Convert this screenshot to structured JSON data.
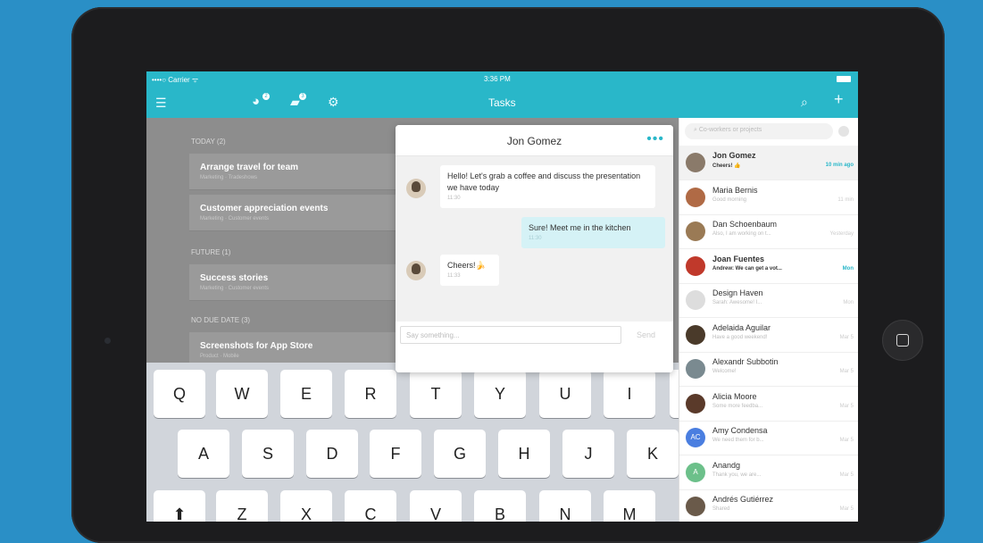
{
  "status": {
    "carrier": "••••○ Carrier ᯤ",
    "time": "3:36 PM"
  },
  "nav": {
    "title": "Tasks",
    "badge1": "2",
    "badge2": "3"
  },
  "tasks": {
    "sections": [
      {
        "label": "TODAY (2)",
        "items": [
          {
            "title": "Arrange travel for team",
            "sub": "Marketing · Tradeshows"
          },
          {
            "title": "Customer appreciation events",
            "sub": "Marketing · Customer events"
          }
        ]
      },
      {
        "label": "FUTURE (1)",
        "items": [
          {
            "title": "Success stories",
            "sub": "Marketing · Customer events"
          }
        ]
      },
      {
        "label": "NO DUE DATE (3)",
        "items": [
          {
            "title": "Screenshots for App Store",
            "sub": "Product · Mobile"
          }
        ]
      }
    ]
  },
  "chat": {
    "name": "Jon Gomez",
    "more": "•••",
    "messages": [
      {
        "text": "Hello! Let's grab a coffee and discuss the presentation we have today",
        "time": "11:30"
      },
      {
        "text": "Sure! Meet me in the kitchen",
        "time": "11:30"
      },
      {
        "text": "Cheers!🍌",
        "time": "11:33"
      }
    ],
    "input_placeholder": "Say something...",
    "send_label": "Send"
  },
  "keyboard": {
    "row1": [
      "Q",
      "W",
      "E",
      "R",
      "T",
      "Y",
      "U",
      "I"
    ],
    "row2": [
      "A",
      "S",
      "D",
      "F",
      "G",
      "H",
      "J",
      "K"
    ],
    "shift": "⬆",
    "row3": [
      "Z",
      "X",
      "C",
      "V",
      "B",
      "N",
      "M"
    ]
  },
  "sidebar": {
    "search_placeholder": "Co-workers or projects",
    "contacts": [
      {
        "name": "Jon Gomez",
        "msg": "Cheers! 👍",
        "time": "10 min ago",
        "bold": true,
        "color": "#8a7a6a"
      },
      {
        "name": "Maria Bernis",
        "msg": "Good morning",
        "time": "11 min",
        "bold": false,
        "color": "#b06a45"
      },
      {
        "name": "Dan Schoenbaum",
        "msg": "Also, I am working on t...",
        "time": "Yesterday",
        "bold": false,
        "color": "#9a7a55"
      },
      {
        "name": "Joan Fuentes",
        "msg": "Andrew: We can get a vot...",
        "time": "Mon",
        "bold": true,
        "color": "#c0392b"
      },
      {
        "name": "Design Haven",
        "msg": "Sarah: Awesome! I...",
        "time": "Mon",
        "bold": false,
        "color": "#dddddd"
      },
      {
        "name": "Adelaida Aguilar",
        "msg": "Have a good weekend!",
        "time": "Mar 5",
        "bold": false,
        "color": "#4a3a2a"
      },
      {
        "name": "Alexandr Subbotin",
        "msg": "Welcome!",
        "time": "Mar 5",
        "bold": false,
        "color": "#7a8a90"
      },
      {
        "name": "Alicia Moore",
        "msg": "Some more feedba...",
        "time": "Mar 5",
        "bold": false,
        "color": "#5a3a2a"
      },
      {
        "name": "Amy Condensa",
        "msg": "We need them for b...",
        "time": "Mar 5",
        "bold": false,
        "color": "#4a7ee0",
        "initials": "AC"
      },
      {
        "name": "Anandg",
        "msg": "Thank you, we are...",
        "time": "Mar 5",
        "bold": false,
        "color": "#6cc08a",
        "initials": "A"
      },
      {
        "name": "Andrés Gutiérrez",
        "msg": "Shared",
        "time": "Mar 5",
        "bold": false,
        "color": "#6a5a4a"
      }
    ]
  }
}
